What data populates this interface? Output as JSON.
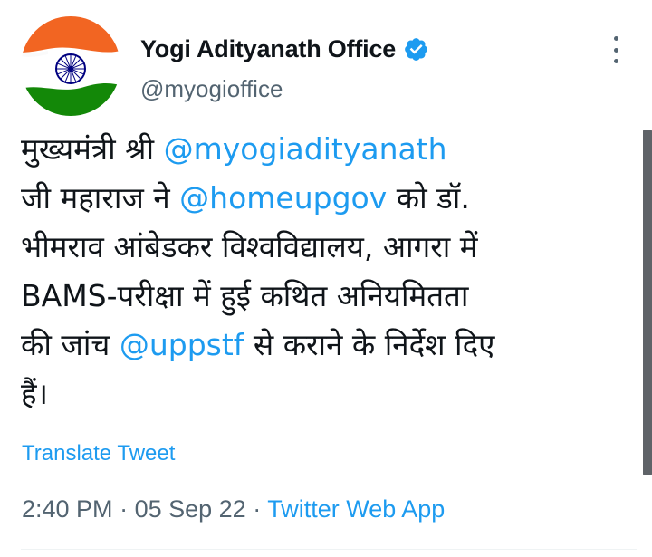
{
  "author": {
    "display_name": "Yogi Adityanath Office",
    "handle": "@myogioffice",
    "verified": true,
    "avatar_icon": "indian-flag-avatar"
  },
  "tweet": {
    "line1_pre": "मुख्यमंत्री श्री ",
    "mention1": "@myogiadityanath",
    "line2_pre": "जी महाराज ने ",
    "mention2": "@homeupgov",
    "line2_post": " को डॉ.",
    "line3": "भीमराव आंबेडकर विश्वविद्यालय, आगरा में",
    "line4": "BAMS-परीक्षा में हुई कथित अनियमितता",
    "line5_pre": "की जांच ",
    "mention3": "@uppstf",
    "line5_post": " से कराने के निर्देश दिए",
    "line6": "हैं।"
  },
  "translate_label": "Translate Tweet",
  "meta": {
    "time": "2:40 PM",
    "separator": "·",
    "date": "05 Sep 22",
    "source": "Twitter Web App"
  },
  "colors": {
    "accent": "#1d9bf0",
    "text": "#0f1419",
    "muted": "#536471",
    "saffron": "#f26522",
    "green": "#138808",
    "chakra": "#000080"
  },
  "icons": {
    "verified": "verified-badge-icon",
    "more": "more-options-icon"
  }
}
